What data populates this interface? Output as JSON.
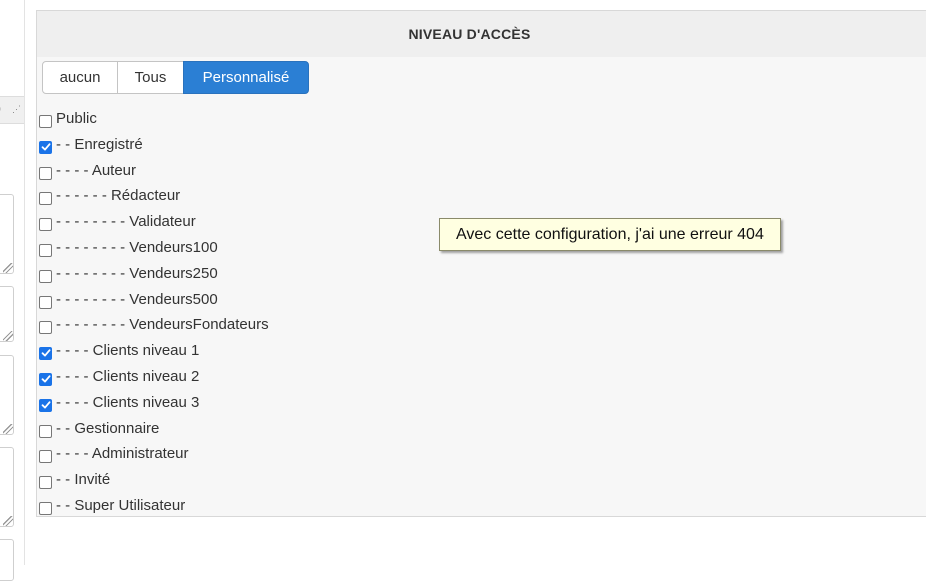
{
  "panel": {
    "title": "NIVEAU D'ACCÈS"
  },
  "buttons": [
    {
      "label": "aucun",
      "active": false
    },
    {
      "label": "Tous",
      "active": false
    },
    {
      "label": "Personnalisé",
      "active": true
    }
  ],
  "groups": [
    {
      "label": "Public",
      "checked": false
    },
    {
      "label": "- - Enregistré",
      "checked": true
    },
    {
      "label": "- - - - Auteur",
      "checked": false
    },
    {
      "label": "- - - - - - Rédacteur",
      "checked": false
    },
    {
      "label": "- - - - - - - - Validateur",
      "checked": false
    },
    {
      "label": "- - - - - - - - Vendeurs100",
      "checked": false
    },
    {
      "label": "- - - - - - - - Vendeurs250",
      "checked": false
    },
    {
      "label": "- - - - - - - - Vendeurs500",
      "checked": false
    },
    {
      "label": "- - - - - - - - VendeursFondateurs",
      "checked": false
    },
    {
      "label": "- - - - Clients niveau 1",
      "checked": true
    },
    {
      "label": "- - - - Clients niveau 2",
      "checked": true
    },
    {
      "label": "- - - - Clients niveau 3",
      "checked": true
    },
    {
      "label": "- - Gestionnaire",
      "checked": false
    },
    {
      "label": "- - - - Administrateur",
      "checked": false
    },
    {
      "label": "- - Invité",
      "checked": false
    },
    {
      "label": "- - Super Utilisateur",
      "checked": false
    }
  ],
  "tooltip": {
    "text": "Avec cette configuration, j'ai une erreur 404"
  },
  "colors": {
    "accent": "#2b7fd4",
    "checkbox": "#1a73e8",
    "tooltip_bg": "#ffffe1"
  },
  "icons": {
    "editor_partial": "editor-icon",
    "grip": "grip-icon"
  }
}
